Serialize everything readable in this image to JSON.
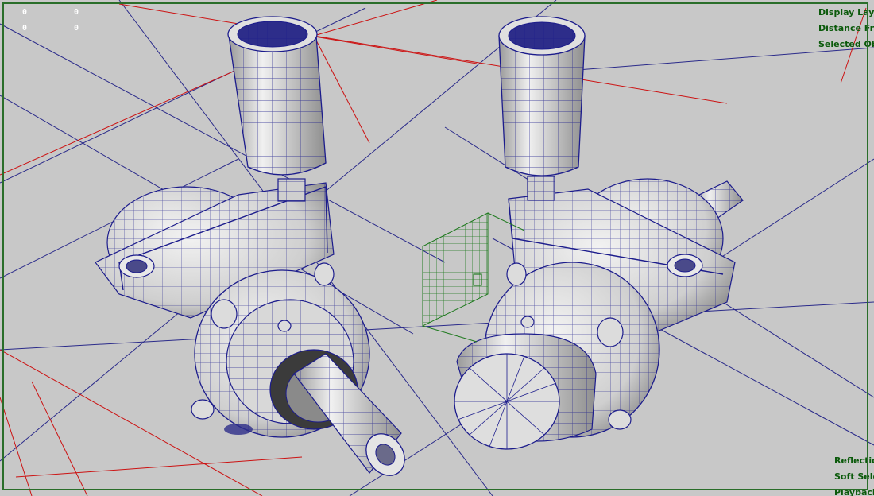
{
  "hud": {
    "top_right": [
      "Display Layer",
      "Distance From Camera",
      "Selected Objects"
    ],
    "bottom_right": [
      "Reflection",
      "Soft Select",
      "Playback"
    ]
  },
  "counters": [
    "0",
    "0",
    "0",
    "0"
  ],
  "colors": {
    "viewport_bg": "#c8c8c8",
    "wire": "#1c1c8c",
    "grid": "#2a2a8a",
    "red_line": "#cc1111",
    "selection_grid": "#1f7a1f",
    "hud_text": "#0b5a0b"
  }
}
